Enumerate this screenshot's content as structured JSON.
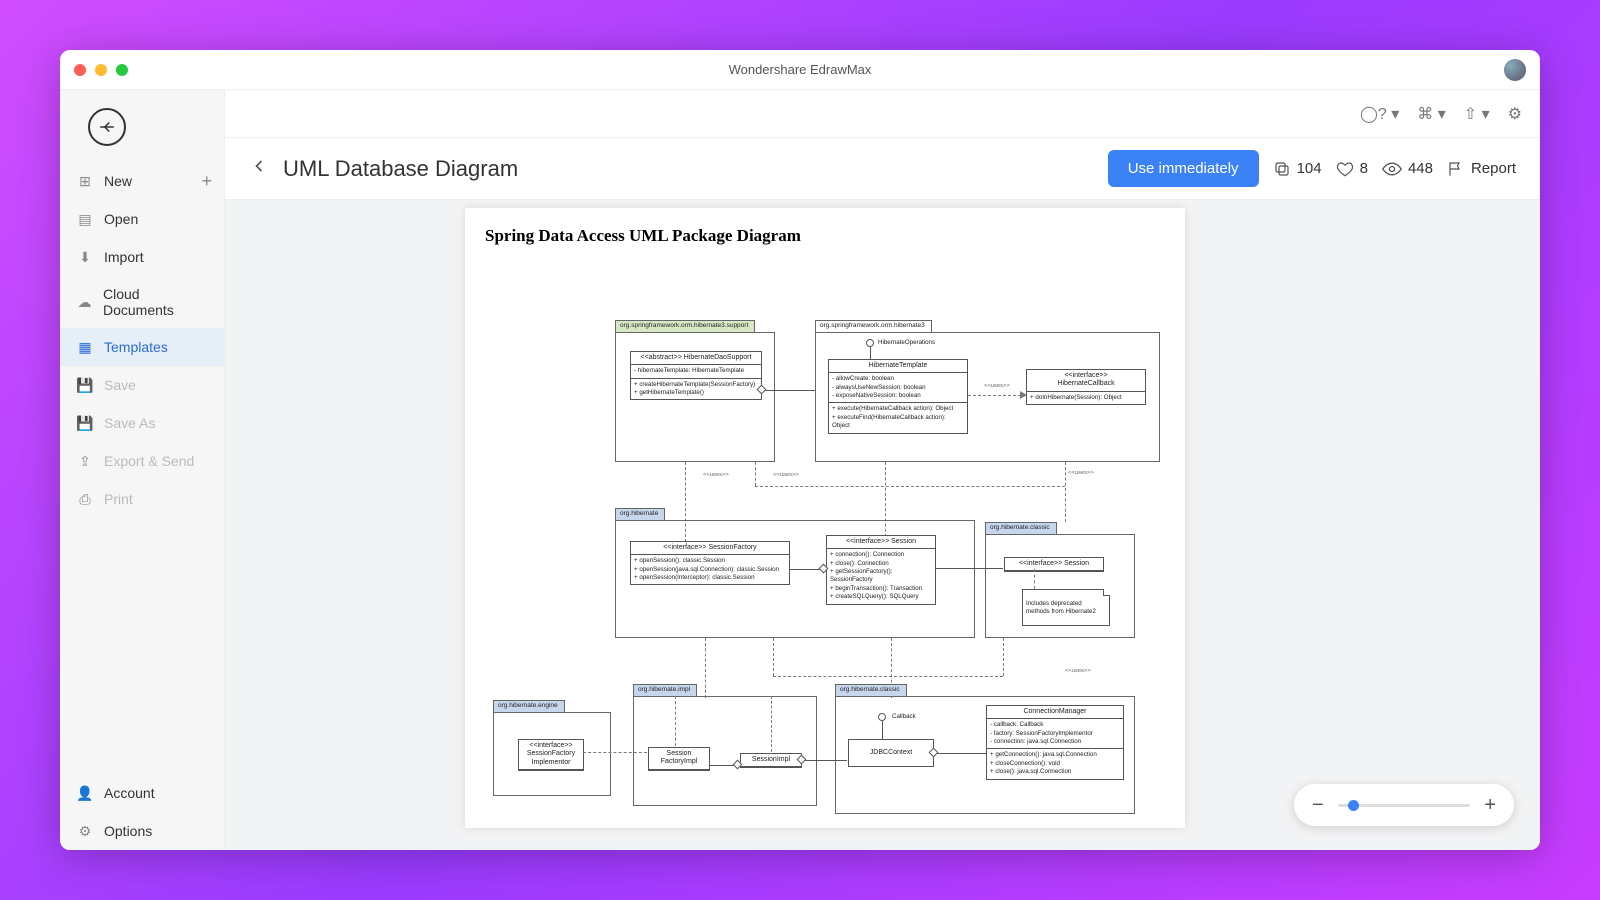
{
  "titlebar": {
    "title": "Wondershare EdrawMax"
  },
  "sidebar": {
    "items": [
      {
        "label": "New",
        "icon": "plus"
      },
      {
        "label": "Open",
        "icon": "folder"
      },
      {
        "label": "Import",
        "icon": "import"
      },
      {
        "label": "Cloud Documents",
        "icon": "cloud"
      },
      {
        "label": "Templates",
        "icon": "grid"
      },
      {
        "label": "Save",
        "icon": "save"
      },
      {
        "label": "Save As",
        "icon": "saveas"
      },
      {
        "label": "Export & Send",
        "icon": "export"
      },
      {
        "label": "Print",
        "icon": "print"
      }
    ],
    "footer": [
      {
        "label": "Account",
        "icon": "user"
      },
      {
        "label": "Options",
        "icon": "gear"
      }
    ]
  },
  "header": {
    "page_title": "UML Database Diagram",
    "use_btn": "Use immediately",
    "copies": "104",
    "likes": "8",
    "views": "448",
    "report": "Report"
  },
  "diagram": {
    "paper_title": "Spring Data Access UML Package Diagram",
    "packages": {
      "p1": {
        "tab": "org.springframework.orm.hibernate3.support"
      },
      "p2": {
        "tab": "org.springframework.orm.hibernate3"
      },
      "p3": {
        "tab": "org.hibernate"
      },
      "p4": {
        "tab": "org.hibernate.classic"
      },
      "p5": {
        "tab": "org.hibernate.impl"
      },
      "p6": {
        "tab": "org.hibernate.classic"
      },
      "p7": {
        "tab": "org.hibernate.engine"
      }
    },
    "stereotypes": {
      "uses": "<<uses>>"
    },
    "classes": {
      "hiber_dao_support": {
        "title": "<<abstract>> HibernateDaoSupport",
        "a1": "- hibernateTemplate: HibernateTemplate",
        "m1": "+ createHibernateTemplate(SessionFactory)",
        "m2": "+ getHibernateTemplate()"
      },
      "hiber_ops": {
        "iface_name": "HibernateOperations"
      },
      "hiber_template": {
        "title": "HibernateTemplate",
        "a1": "- allowCreate: boolean",
        "a2": "- alwaysUseNewSession: boolean",
        "a3": "- exposeNativeSession: boolean",
        "m1": "+ execute(HibernateCallback action): Object",
        "m2": "+ executeFind(HibernateCallback action): Object"
      },
      "hiber_callback": {
        "title": "<<interface>>\nHibernateCallback",
        "m1": "+ doInHibernate(Session): Object"
      },
      "session_factory": {
        "title": "<<interface>> SessionFactory",
        "m1": "+ openSession(): classic.Session",
        "m2": "+ openSession(java.sql.Connection): classic.Session",
        "m3": "+ openSession(Interceptor): classic.Session"
      },
      "session": {
        "title": "<<interface>> Session",
        "m1": "+ connection(): Connection",
        "m2": "+ close(): Connection",
        "m3": "+ getSessionFactory(): SessionFactory",
        "m4": "+ beginTransaction(): Transaction",
        "m5": "+ createSQLQuery(): SQLQuery"
      },
      "classic_session": {
        "title": "<<interface>> Session"
      },
      "classic_note": "Includes deprecated\nmethods from Hibernate2",
      "sf_interf": {
        "title": "<<interface>>\nSessionFactory\nImplementor"
      },
      "sf_impl": {
        "title": "Session\nFactoryImpl"
      },
      "session_impl": {
        "title": "SessionImpl"
      },
      "callback_iface": {
        "iface_name": "Callback"
      },
      "jdbc_context": {
        "title": "JDBCContext"
      },
      "conn_mgr": {
        "title": "ConnectionManager",
        "a1": "- callback: Callback",
        "a2": "- factory: SessionFactoryImplementor",
        "a3": "- connection: java.sql.Connection",
        "m1": "+ getConnection(): java.sql.Connection",
        "m2": "+ closeConnection(): void",
        "m3": "+ close(): java.sql.Connection"
      }
    }
  }
}
